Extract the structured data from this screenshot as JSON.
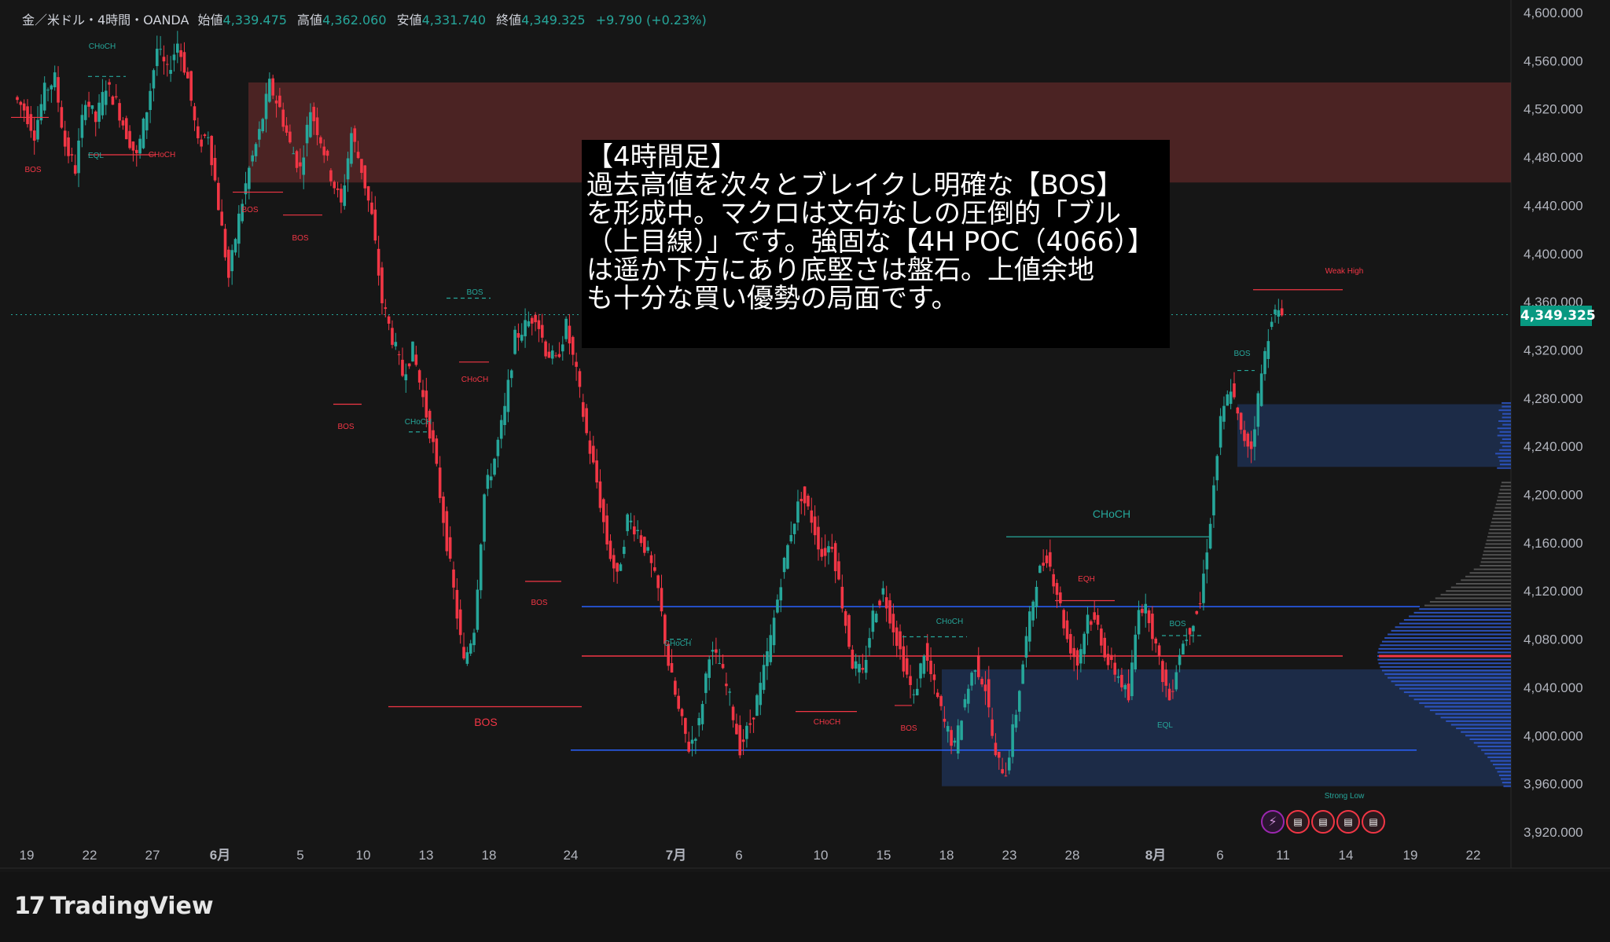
{
  "header": {
    "symbol": "金／米ドル・4時間・OANDA",
    "open_label": "始値",
    "open": "4,339.475",
    "high_label": "高値",
    "high": "4,362.060",
    "low_label": "安値",
    "low": "4,331.740",
    "close_label": "終値",
    "close": "4,349.325",
    "change": "+9.790 (+0.23%)"
  },
  "note_lines": [
    "【4時間足】",
    "過去高値を次々とブレイクし明確な【BOS】",
    "を形成中。マクロは文句なしの圧倒的「ブル",
    "（上目線）」です。強固な【4H POC（4066）】",
    "は遥か下方にあり底堅さは盤石。上値余地",
    "も十分な買い優勢の局面です。"
  ],
  "current_price": "4,349.325",
  "footer": {
    "brand": "TradingView",
    "logo_glyph": "17"
  },
  "events": [
    "lightning-icon",
    "us-flag-icon",
    "us-flag-icon",
    "us-flag-icon",
    "us-flag-icon"
  ],
  "colors": {
    "up": "#26a69a",
    "down": "#f23645",
    "bg": "#161616",
    "zone_red": "#5c2a2a",
    "zone_blue": "#1e3a6e",
    "profile": "#2f5bd6"
  },
  "chart_data": {
    "type": "candlestick",
    "y_ticks": [
      "4,600.000",
      "4,560.000",
      "4,520.000",
      "4,480.000",
      "4,440.000",
      "4,400.000",
      "4,360.000",
      "4,320.000",
      "4,280.000",
      "4,240.000",
      "4,200.000",
      "4,160.000",
      "4,120.000",
      "4,080.000",
      "4,040.000",
      "4,000.000",
      "3,960.000",
      "3,920.000"
    ],
    "ylim": [
      3913,
      4605
    ],
    "x_ticks": [
      "19",
      "22",
      "27",
      "6月",
      "5",
      "10",
      "13",
      "18",
      "24",
      "7月",
      "6",
      "10",
      "15",
      "18",
      "23",
      "28",
      "8月",
      "6",
      "11",
      "14",
      "19",
      "22"
    ],
    "close_series": [
      4520,
      4500,
      4535,
      4545,
      4490,
      4470,
      4530,
      4510,
      4540,
      4525,
      4500,
      4480,
      4520,
      4570,
      4550,
      4575,
      4545,
      4490,
      4500,
      4440,
      4380,
      4430,
      4470,
      4500,
      4540,
      4520,
      4490,
      4470,
      4520,
      4495,
      4465,
      4440,
      4500,
      4470,
      4430,
      4360,
      4330,
      4300,
      4320,
      4280,
      4240,
      4180,
      4120,
      4060,
      4090,
      4200,
      4230,
      4270,
      4330,
      4340,
      4350,
      4320,
      4310,
      4340,
      4300,
      4250,
      4210,
      4160,
      4130,
      4180,
      4170,
      4150,
      4120,
      4060,
      4020,
      3990,
      4010,
      4070,
      4060,
      4030,
      3990,
      4010,
      4040,
      4080,
      4130,
      4170,
      4200,
      4180,
      4150,
      4160,
      4110,
      4060,
      4050,
      4100,
      4120,
      4090,
      4060,
      4030,
      4070,
      4040,
      4010,
      3990,
      4030,
      4060,
      4040,
      3980,
      3970,
      4020,
      4080,
      4130,
      4150,
      4120,
      4080,
      4060,
      4100,
      4090,
      4060,
      4050,
      4030,
      4110,
      4100,
      4060,
      4030,
      4070,
      4090,
      4110,
      4180,
      4260,
      4290,
      4250,
      4240,
      4300,
      4350,
      4349
    ],
    "levels": [
      {
        "price": 4107,
        "color": "#2962ff"
      },
      {
        "price": 4066,
        "color": "#f23645"
      },
      {
        "price": 3988,
        "color": "#2962ff"
      }
    ],
    "zones": [
      {
        "from": 4459,
        "to": 4542,
        "color": "red"
      },
      {
        "from": 4223,
        "to": 4275,
        "color": "blue"
      },
      {
        "from": 3958,
        "to": 4055,
        "color": "blue"
      }
    ],
    "annotations": [
      {
        "text": "BOS",
        "color": "#f23645"
      },
      {
        "text": "BOS",
        "color": "#f23645"
      },
      {
        "text": "BOS",
        "color": "#f23645"
      },
      {
        "text": "BOS",
        "color": "#f23645"
      },
      {
        "text": "BOS",
        "color": "#f23645"
      },
      {
        "text": "BOS",
        "color": "#f23645"
      },
      {
        "text": "BOS",
        "color": "#f23645"
      },
      {
        "text": "BOS",
        "color": "#26a69a"
      },
      {
        "text": "BOS",
        "color": "#26a69a"
      },
      {
        "text": "BOS",
        "color": "#26a69a"
      },
      {
        "text": "CHoCH",
        "color": "#26a69a"
      },
      {
        "text": "CHoCH",
        "color": "#f23645"
      },
      {
        "text": "EQL",
        "color": "#26a69a"
      },
      {
        "text": "CHoCH",
        "color": "#f23645"
      },
      {
        "text": "CHoCH",
        "color": "#26a69a"
      },
      {
        "text": "CHoCH",
        "color": "#26a69a"
      },
      {
        "text": "CHoCH",
        "color": "#f23645"
      },
      {
        "text": "CHoCH",
        "color": "#26a69a"
      },
      {
        "text": "CHoCH",
        "color": "#26a69a"
      },
      {
        "text": "EQH",
        "color": "#f23645"
      },
      {
        "text": "EQL",
        "color": "#26a69a"
      },
      {
        "text": "Weak High",
        "color": "#f23645"
      },
      {
        "text": "Strong Low",
        "color": "#26a69a"
      }
    ]
  }
}
